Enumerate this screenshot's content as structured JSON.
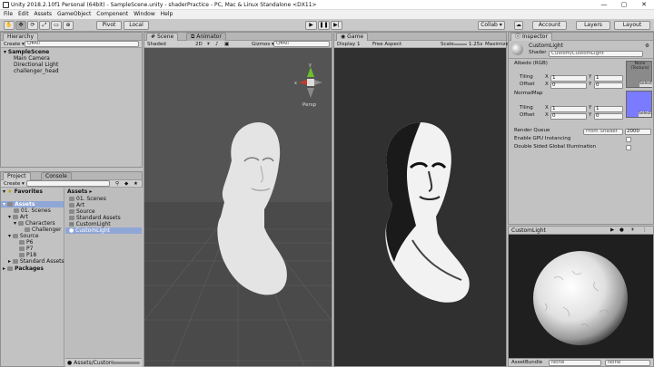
{
  "titlebar": {
    "title": "Unity 2018.2.10f1 Personal (64bit) - SampleScene.unity - shaderPractice - PC, Mac & Linux Standalone <DX11>",
    "min": "—",
    "max": "▢",
    "close": "✕"
  },
  "menu": [
    "File",
    "Edit",
    "Assets",
    "GameObject",
    "Component",
    "Window",
    "Help"
  ],
  "toolbar": {
    "pivot": "Pivot",
    "local": "Local",
    "collab": "Collab ▾",
    "account": "Account",
    "layers": "Layers",
    "layout": "Layout"
  },
  "hierarchy": {
    "tab": "Hierarchy",
    "create": "Create ▾",
    "search": "Q▾All",
    "scene": "SampleScene",
    "items": [
      "Main Camera",
      "Directional Light",
      "challenger_head"
    ]
  },
  "scene": {
    "tab": "Scene",
    "animator_tab": "Animator",
    "shading": "Shaded",
    "mode2d": "2D",
    "gizmos": "Gizmos ▾",
    "search": "Q▾All",
    "persp": "Persp",
    "axis_y": "y",
    "axis_x": "x"
  },
  "game": {
    "tab": "Game",
    "display": "Display 1",
    "aspect": "Free Aspect",
    "scale_label": "Scale",
    "scale_value": "1.25x",
    "maximize": "Maximize"
  },
  "inspector": {
    "tab": "Inspector",
    "name": "CustomLight",
    "shader_label": "Shader",
    "shader_value": "Custom/CustomLight",
    "albedo_label": "Albedo (RGB)",
    "albedo_slot": "None (Texture)",
    "select": "Select",
    "tiling": "Tiling",
    "offset": "Offset",
    "x": "X",
    "y": "Y",
    "albedo_tiling_x": "1",
    "albedo_tiling_y": "1",
    "albedo_offset_x": "0",
    "albedo_offset_y": "0",
    "normal_label": "NormalMap",
    "normal_tiling_x": "1",
    "normal_tiling_y": "1",
    "normal_offset_x": "0",
    "normal_offset_y": "0",
    "render_queue_label": "Render Queue",
    "render_queue_mode": "From Shader",
    "render_queue_value": "2000",
    "gpu_instancing": "Enable GPU Instancing",
    "double_sided": "Double Sided Global Illumination",
    "normal_color": "#7b7bff"
  },
  "preview": {
    "title": "CustomLight",
    "assetbundle_label": "AssetBundle",
    "assetbundle_value": "None",
    "variant_value": "None"
  },
  "project": {
    "tab": "Project",
    "console_tab": "Console",
    "create": "Create ▾",
    "favorites": "Favorites",
    "tree": [
      {
        "label": "Assets",
        "level": 0,
        "selected": true
      },
      {
        "label": "01. Scenes",
        "level": 1
      },
      {
        "label": "Art",
        "level": 1
      },
      {
        "label": "Characters",
        "level": 2
      },
      {
        "label": "Challenger",
        "level": 3
      },
      {
        "label": "Source",
        "level": 1
      },
      {
        "label": "P6",
        "level": 2
      },
      {
        "label": "P7",
        "level": 2
      },
      {
        "label": "P18",
        "level": 2
      },
      {
        "label": "Standard Assets",
        "level": 1
      },
      {
        "label": "Packages",
        "level": 0
      }
    ],
    "breadcrumb": "Assets ▸",
    "files": [
      "01. Scenes",
      "Art",
      "Source",
      "Standard Assets",
      "CustomLight",
      "CustomLight"
    ],
    "selected_file_index": 5,
    "footer_path": "Assets/Custom"
  }
}
